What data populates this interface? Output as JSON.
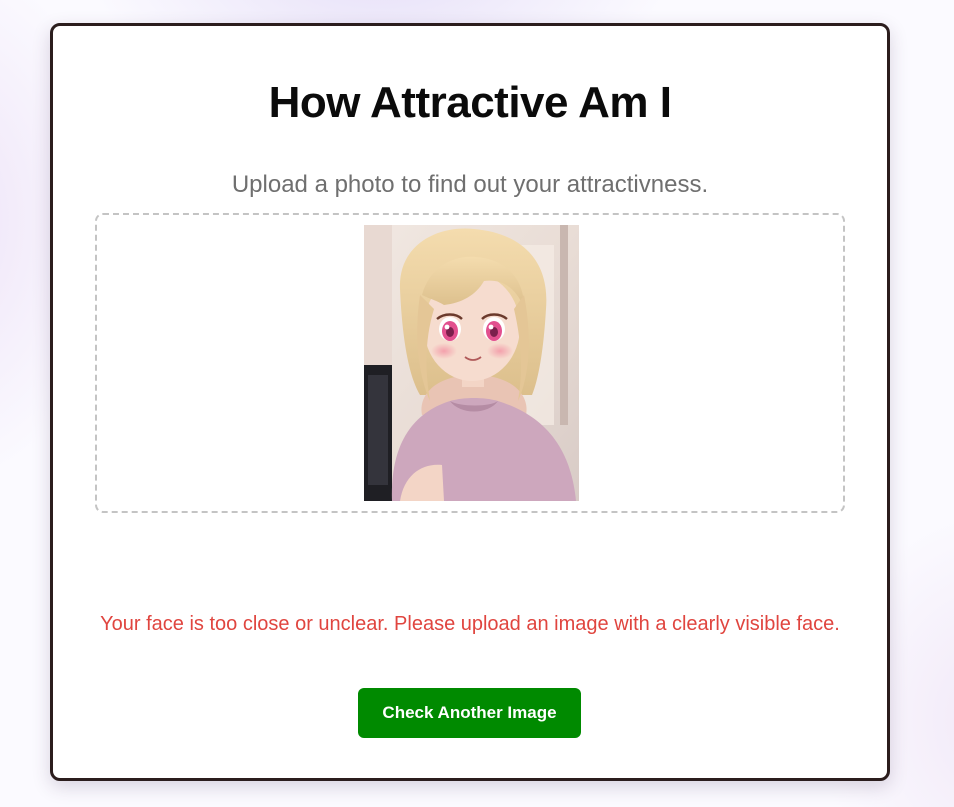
{
  "app": {
    "title": "How Attractive Am I",
    "subtitle": "Upload a photo to find out your attractivness."
  },
  "upload": {
    "preview_subject": "anime-style girl with blonde hair and pink shirt"
  },
  "result": {
    "error_message": "Your face is too close or unclear. Please upload an image with a clearly visible face."
  },
  "actions": {
    "retry_label": "Check Another Image"
  },
  "colors": {
    "error": "#e0453f",
    "button": "#008a00",
    "card_border": "#2b1d1d"
  }
}
